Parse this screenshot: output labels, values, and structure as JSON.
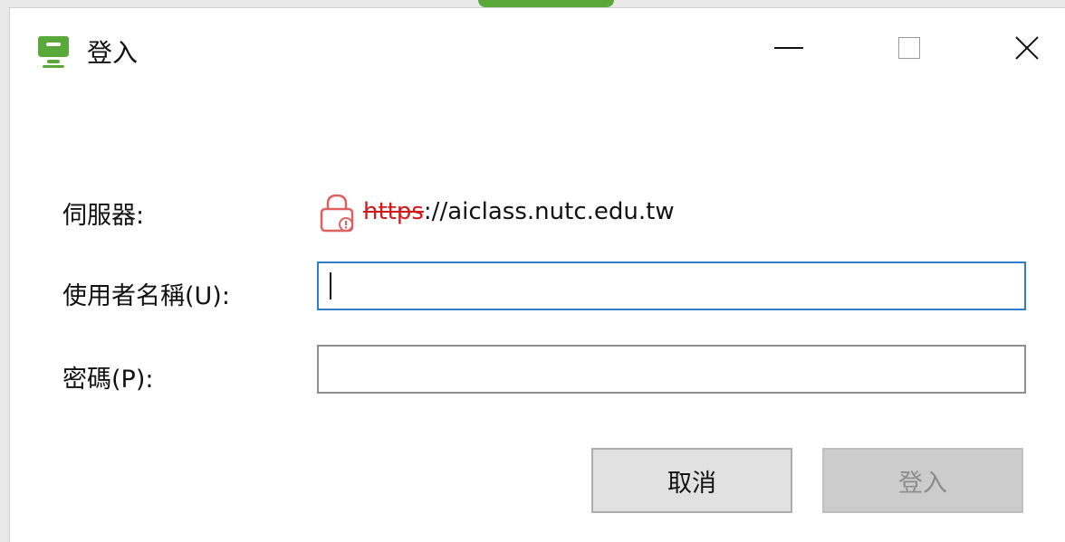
{
  "window": {
    "title": "登入"
  },
  "form": {
    "server_label": "伺服器:",
    "server_scheme": "https",
    "server_rest": "://aiclass.nutc.edu.tw",
    "username_label": "使用者名稱(U):",
    "username_value": "",
    "password_label": "密碼(P):",
    "password_value": ""
  },
  "buttons": {
    "cancel_label": "取消",
    "login_label": "登入"
  },
  "colors": {
    "accent_green": "#5aa83a",
    "focus_blue": "#2f7dd1",
    "insecure_red": "#d21a1a"
  }
}
